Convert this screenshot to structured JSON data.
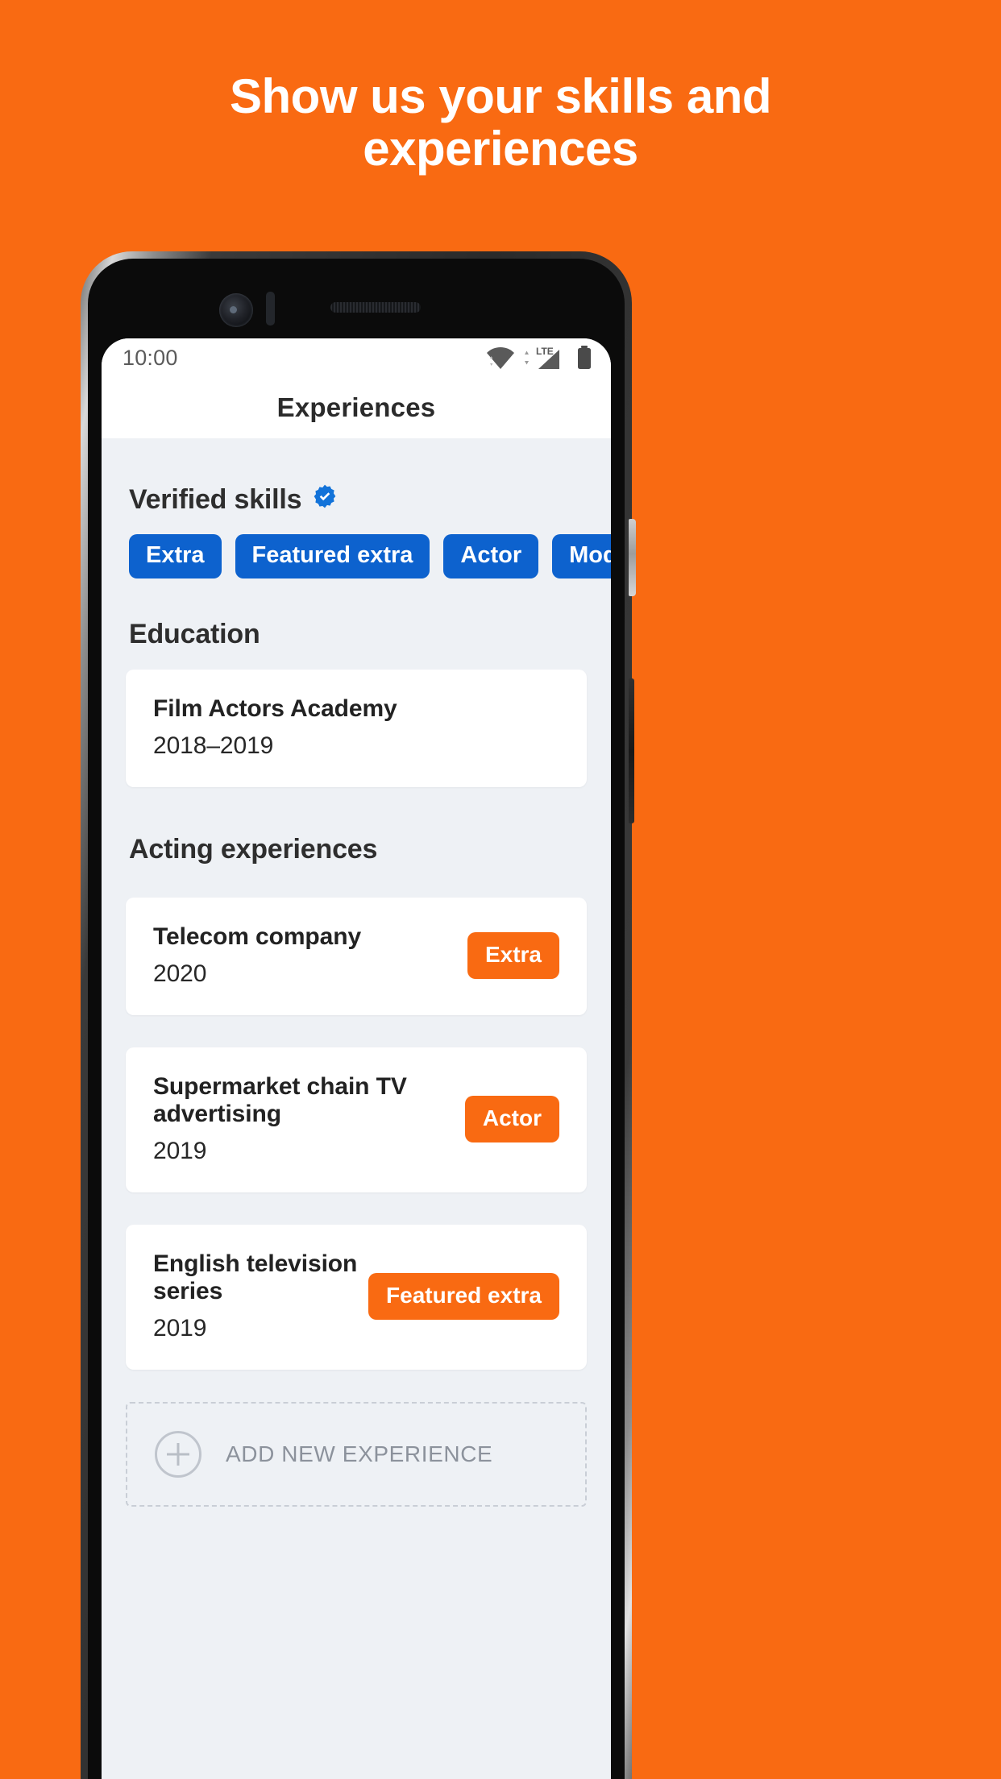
{
  "promo": {
    "headline": "Show us your skills and experiences",
    "background_color": "#F96A12"
  },
  "phone": {
    "status_bar": {
      "time": "10:00",
      "icons": [
        "wifi-icon",
        "lte-signal-icon",
        "battery-icon"
      ],
      "network_label": "LTE"
    },
    "app_bar": {
      "title": "Experiences"
    },
    "verified_skills": {
      "heading": "Verified skills",
      "badge_icon": "verified-check-icon",
      "chip_color": "#0D62CE",
      "chips": [
        {
          "label": "Extra"
        },
        {
          "label": "Featured extra"
        },
        {
          "label": "Actor"
        },
        {
          "label": "Model"
        }
      ]
    },
    "education": {
      "heading": "Education",
      "items": [
        {
          "title": "Film Actors Academy",
          "years": "2018–2019"
        }
      ]
    },
    "acting_experiences": {
      "heading": "Acting experiences",
      "badge_color": "#F96A12",
      "items": [
        {
          "title": "Telecom company",
          "years": "2020",
          "role": "Extra"
        },
        {
          "title": "Supermarket chain TV advertising",
          "years": "2019",
          "role": "Actor"
        },
        {
          "title": "English television series",
          "years": "2019",
          "role": "Featured extra"
        }
      ]
    },
    "add_experience": {
      "label": "ADD NEW EXPERIENCE",
      "icon": "plus-circle-icon"
    }
  }
}
